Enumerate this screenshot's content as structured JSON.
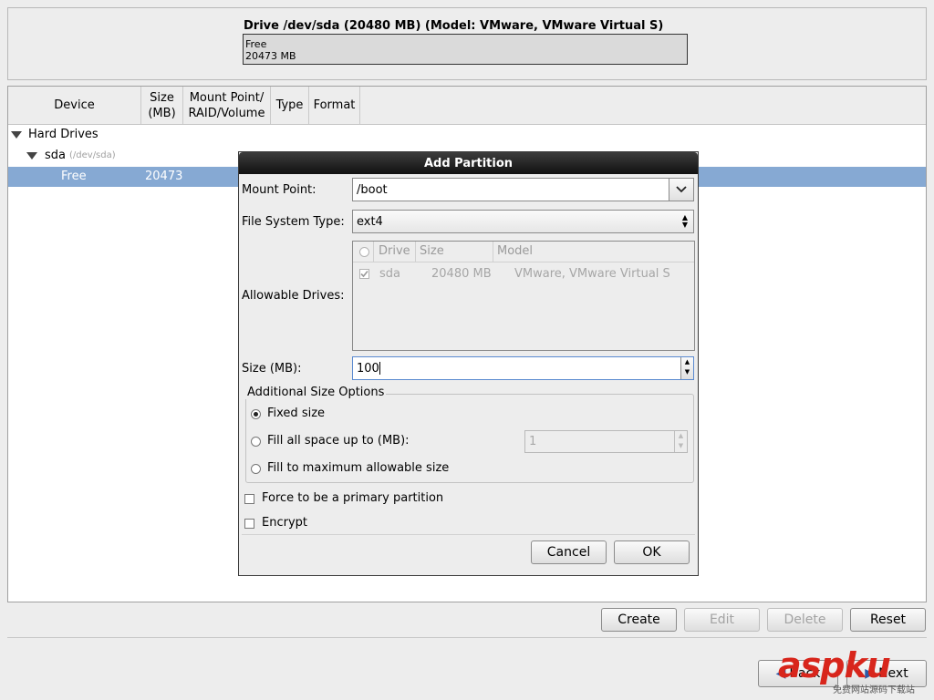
{
  "drive": {
    "title": "Drive /dev/sda (20480 MB) (Model: VMware, VMware Virtual S)",
    "bar_line1": "Free",
    "bar_line2": "20473 MB"
  },
  "table": {
    "headers": [
      "Device",
      "Size\n(MB)",
      "Mount Point/\nRAID/Volume",
      "Type",
      "Format"
    ],
    "hard_drives_label": "Hard Drives",
    "sda_label": "sda",
    "sda_path": "(/dev/sda)",
    "free_label": "Free",
    "free_size": "20473"
  },
  "dialog": {
    "title": "Add Partition",
    "mount_point_label": "Mount Point:",
    "mount_point_value": "/boot",
    "fs_type_label": "File System Type:",
    "fs_type_value": "ext4",
    "allowable_drives_label": "Allowable Drives:",
    "drives_columns": [
      "Drive",
      "Size",
      "Model"
    ],
    "drives_rows": [
      {
        "drive": "sda",
        "size": "20480 MB",
        "model": "VMware, VMware Virtual S",
        "checked": true
      }
    ],
    "size_label": "Size (MB):",
    "size_value": "100",
    "size_options_title": "Additional Size Options",
    "opt_fixed": "Fixed size",
    "opt_fill_up_to": "Fill all space up to (MB):",
    "fill_up_to_value": "1",
    "opt_fill_max": "Fill to maximum allowable size",
    "force_primary": "Force to be a primary partition",
    "encrypt": "Encrypt",
    "cancel": "Cancel",
    "ok": "OK"
  },
  "buttons": {
    "create": "Create",
    "edit": "Edit",
    "delete": "Delete",
    "reset": "Reset",
    "back": "Back",
    "next": "Next"
  },
  "watermark": {
    "logo": "aspku",
    "sub": "免费网站源码下载站"
  },
  "colors": {
    "selection": "#86a9d3",
    "dialog_title_bg": "#1e1e1e",
    "watermark_red": "#d8261c"
  }
}
